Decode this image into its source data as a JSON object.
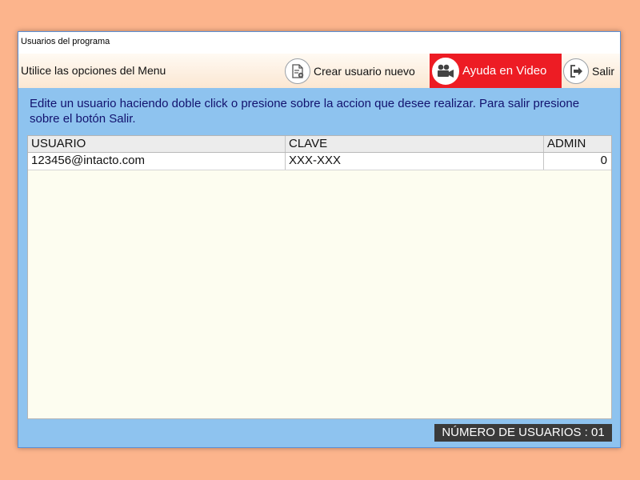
{
  "window": {
    "title": "Usuarios del programa"
  },
  "menubar": {
    "hint": "Utilice las opciones del Menu",
    "buttons": {
      "crear": {
        "label": "Crear usuario nuevo",
        "icon": "user-document-icon"
      },
      "ayuda": {
        "label": "Ayuda en Video",
        "icon": "video-camera-icon",
        "background": "#ed1c24"
      },
      "salir": {
        "label": "Salir",
        "icon": "exit-icon"
      }
    }
  },
  "instructions": "Edite un usuario haciendo doble click o presione sobre la accion que desee realizar. Para salir presione sobre el botón Salir.",
  "grid": {
    "columns": [
      "USUARIO",
      "CLAVE",
      "ADMIN"
    ],
    "rows": [
      {
        "usuario": "123456@intacto.com",
        "clave": "XXX-XXX",
        "admin": "0"
      }
    ]
  },
  "status": {
    "count_label": "NÚMERO DE USUARIOS : 01"
  },
  "colors": {
    "page_background": "#fcb48c",
    "content_background": "#8ec3ef",
    "accent_red": "#ed1c24",
    "status_background": "#3a3a3a"
  }
}
